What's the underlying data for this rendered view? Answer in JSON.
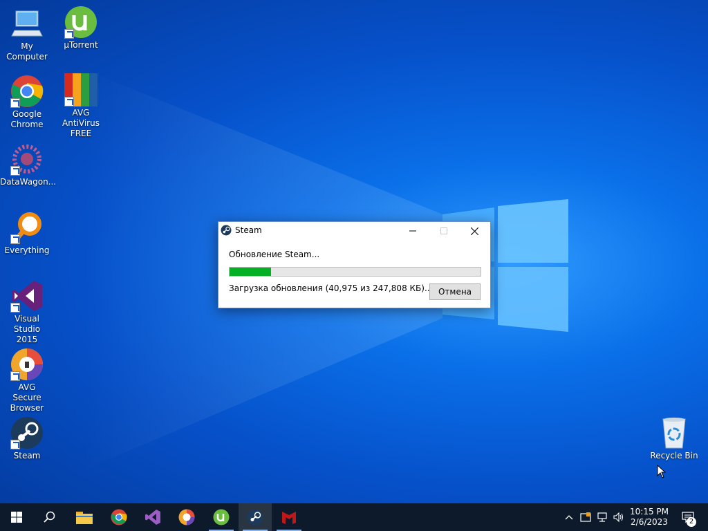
{
  "desktop": {
    "icons": [
      {
        "label": "My Computer"
      },
      {
        "label": "μTorrent"
      },
      {
        "label": "Google Chrome"
      },
      {
        "label": "AVG AntiVirus FREE"
      },
      {
        "label": "DataWagon..."
      },
      {
        "label": "Everything"
      },
      {
        "label": "Visual Studio 2015"
      },
      {
        "label": "AVG Secure Browser"
      },
      {
        "label": "Steam"
      },
      {
        "label": "Recycle Bin"
      }
    ]
  },
  "dialog": {
    "title": "Steam",
    "heading": "Обновление Steam...",
    "status": "Загрузка обновления (40,975 из 247,808 КБ)...",
    "progress_fraction": 0.165,
    "cancel_label": "Отмена"
  },
  "taskbar": {
    "pinned": [
      {
        "name": "file-explorer-icon"
      },
      {
        "name": "chrome-icon"
      },
      {
        "name": "visual-studio-icon"
      },
      {
        "name": "avg-secure-browser-icon"
      },
      {
        "name": "utorrent-icon"
      },
      {
        "name": "steam-icon"
      },
      {
        "name": "mcafee-icon"
      }
    ],
    "time": "10:15 PM",
    "date": "2/6/2023",
    "notification_count": "2"
  },
  "colors": {
    "progress": "#06b025",
    "taskbar": "#0d1a2b",
    "wallpaper": "#0a6fe8"
  }
}
